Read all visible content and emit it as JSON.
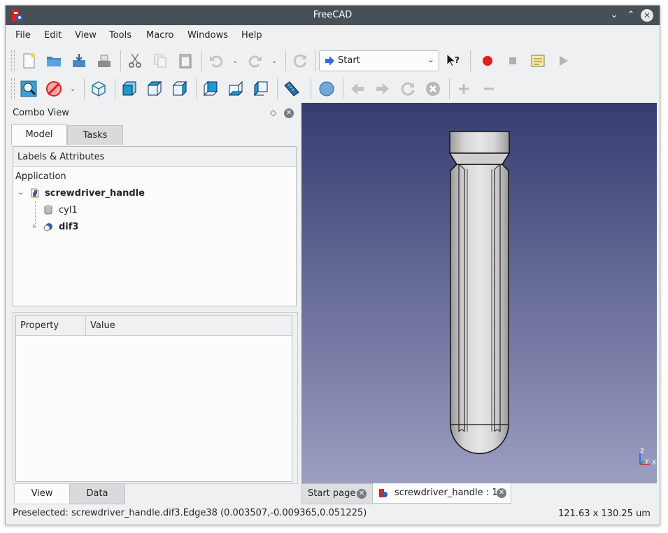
{
  "window": {
    "title": "FreeCAD"
  },
  "menu": [
    "File",
    "Edit",
    "View",
    "Tools",
    "Macro",
    "Windows",
    "Help"
  ],
  "toolbar": {
    "workbench": "Start"
  },
  "combo": {
    "title": "Combo View",
    "tabs": [
      "Model",
      "Tasks"
    ],
    "tree_header": "Labels & Attributes",
    "application_label": "Application",
    "tree": [
      {
        "label": "screwdriver_handle",
        "bold": true
      },
      {
        "label": "cyl1",
        "bold": false
      },
      {
        "label": "dif3",
        "bold": true
      }
    ],
    "property_headers": [
      "Property",
      "Value"
    ],
    "bottom_tabs": [
      "View",
      "Data"
    ]
  },
  "viewport": {
    "axes": {
      "z": "Z",
      "y": "Y",
      "x": "X"
    },
    "tabs": [
      "Start page",
      "screwdriver_handle : 1"
    ]
  },
  "status": {
    "left": "Preselected: screwdriver_handle.dif3.Edge38 (0.003507,-0.009365,0.051225)",
    "right": "121.63 x 130.25 um"
  }
}
